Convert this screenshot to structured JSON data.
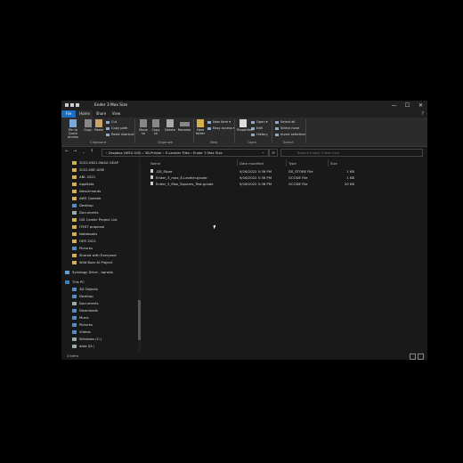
{
  "window": {
    "title": "Ender 3 Max Size",
    "controls": [
      "—",
      "☐",
      "✕"
    ]
  },
  "tabs": [
    {
      "label": "File"
    },
    {
      "label": "Home"
    },
    {
      "label": "Share"
    },
    {
      "label": "View"
    }
  ],
  "ribbon": {
    "pin": "Pin to Quick access",
    "copy": "Copy",
    "paste": "Paste",
    "cut": "Cut",
    "copy_path": "Copy path",
    "paste_shortcut": "Paste shortcut",
    "move_to": "Move to",
    "copy_to": "Copy to",
    "delete": "Delete",
    "rename": "Rename",
    "new_folder": "New folder",
    "new_item": "New item ▾",
    "easy_access": "Easy access ▾",
    "properties": "Properties",
    "open": "Open ▾",
    "edit": "Edit",
    "history": "History",
    "select_all": "Select all",
    "select_none": "Select none",
    "invert_selection": "Invert selection",
    "groups": {
      "clipboard": "Clipboard",
      "organize": "Organize",
      "new": "New",
      "open": "Open",
      "select": "Select"
    }
  },
  "address": {
    "path": "› Dropbox (WSU GIS) › 3D-Printer › E-Leveler Files › Ender 3 Max Size",
    "search_placeholder": "Search Ender 3 Max Size"
  },
  "nav_pane": {
    "items": [
      {
        "label": "2022-0621-NASA GEAP",
        "icon": "folder-icon"
      },
      {
        "label": "2022-NSF-AISE",
        "icon": "folder-icon"
      },
      {
        "label": "ABL 2021",
        "icon": "folder-icon"
      },
      {
        "label": "AppData",
        "icon": "folder-icon"
      },
      {
        "label": "Attachments",
        "icon": "folder-icon"
      },
      {
        "label": "AWS Quester",
        "icon": "folder-icon"
      },
      {
        "label": "Desktop",
        "icon": "desktop-icon"
      },
      {
        "label": "Documents",
        "icon": "documents-icon"
      },
      {
        "label": "GIS Center Project List",
        "icon": "folder-icon"
      },
      {
        "label": "ITEST proposal",
        "icon": "folder-icon"
      },
      {
        "label": "Notebooks",
        "icon": "folder-icon"
      },
      {
        "label": "OER 2021",
        "icon": "folder-icon"
      },
      {
        "label": "Pictures",
        "icon": "pictures-icon"
      },
      {
        "label": "Shared with Everyone",
        "icon": "folder-icon"
      },
      {
        "label": "Wild Boar AI Project",
        "icon": "folder-icon"
      },
      {
        "label": "Synology Drive - aproda",
        "icon": "cloud-icon"
      },
      {
        "label": "This PC",
        "icon": "pc-icon"
      },
      {
        "label": "3D Objects",
        "icon": "objects-icon"
      },
      {
        "label": "Desktop",
        "icon": "desktop-icon"
      },
      {
        "label": "Documents",
        "icon": "documents-icon"
      },
      {
        "label": "Downloads",
        "icon": "downloads-icon"
      },
      {
        "label": "Music",
        "icon": "music-icon"
      },
      {
        "label": "Pictures",
        "icon": "pictures-icon"
      },
      {
        "label": "Videos",
        "icon": "videos-icon"
      },
      {
        "label": "Windows (C:)",
        "icon": "drive-icon"
      },
      {
        "label": "data (D:)",
        "icon": "drive-icon"
      }
    ]
  },
  "file_list": {
    "columns": [
      "Name",
      "Date modified",
      "Type",
      "Size"
    ],
    "rows": [
      {
        "name": ".DS_Store",
        "date": "9/16/2022 5:36 PM",
        "type": "DS_STORE File",
        "size": "1 KB"
      },
      {
        "name": "Ender_3_max_E-Leveler.gcode",
        "date": "9/16/2022 5:36 PM",
        "type": "GCODE File",
        "size": "1 KB"
      },
      {
        "name": "Ender_3_Max_Squares_Test.gcode",
        "date": "9/16/2022 5:36 PM",
        "type": "GCODE File",
        "size": "20 KB"
      }
    ]
  },
  "status": {
    "items": "3 items"
  }
}
